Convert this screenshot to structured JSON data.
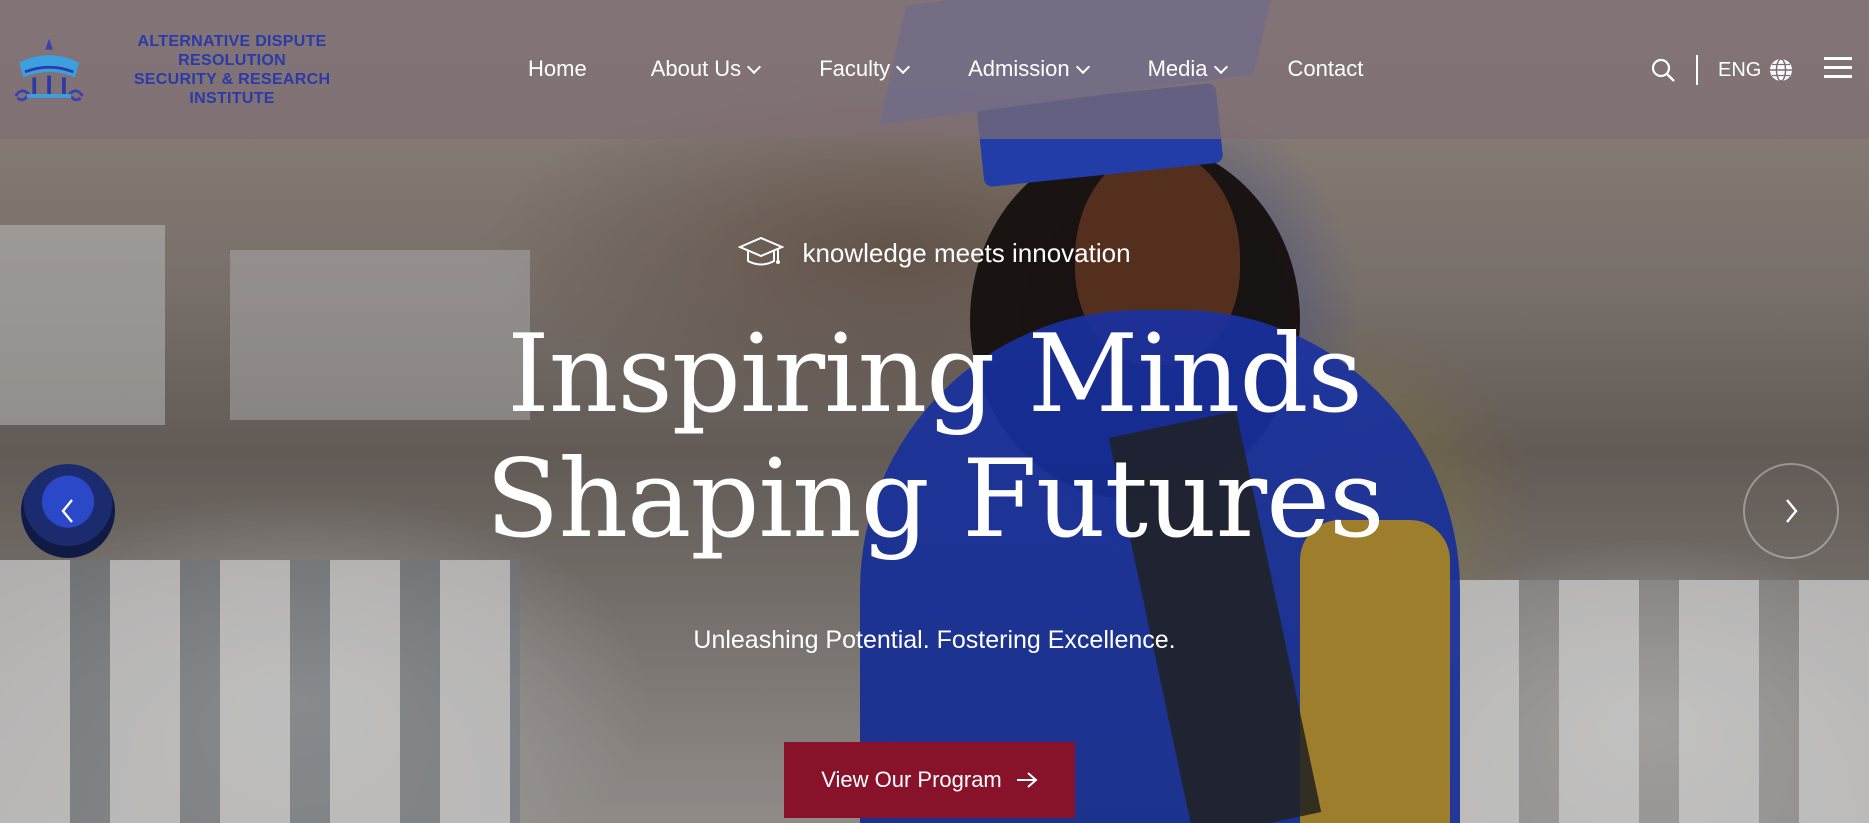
{
  "brand": {
    "line1": "ALTERNATIVE DISPUTE RESOLUTION",
    "line2": "SECURITY & RESEARCH INSTITUTE"
  },
  "nav": {
    "items": [
      {
        "label": "Home",
        "dropdown": false
      },
      {
        "label": "About Us",
        "dropdown": true
      },
      {
        "label": "Faculty",
        "dropdown": true
      },
      {
        "label": "Admission",
        "dropdown": true
      },
      {
        "label": "Media",
        "dropdown": true
      },
      {
        "label": "Contact",
        "dropdown": false
      }
    ]
  },
  "tools": {
    "search_icon": "search-icon",
    "language": "ENG",
    "globe_icon": "globe-icon",
    "menu_icon": "hamburger-menu-icon"
  },
  "hero": {
    "tagline": "knowledge meets innovation",
    "tagline_icon": "graduation-cap-icon",
    "headline_line1": "Inspiring Minds",
    "headline_line2": "Shaping Futures",
    "subline": "Unleashing Potential. Fostering Excellence.",
    "cta_label": "View Our Program",
    "cta_color": "#87122a"
  },
  "colors": {
    "header_overlay": "#7e6d75",
    "brand_blue": "#2a3aa8"
  }
}
